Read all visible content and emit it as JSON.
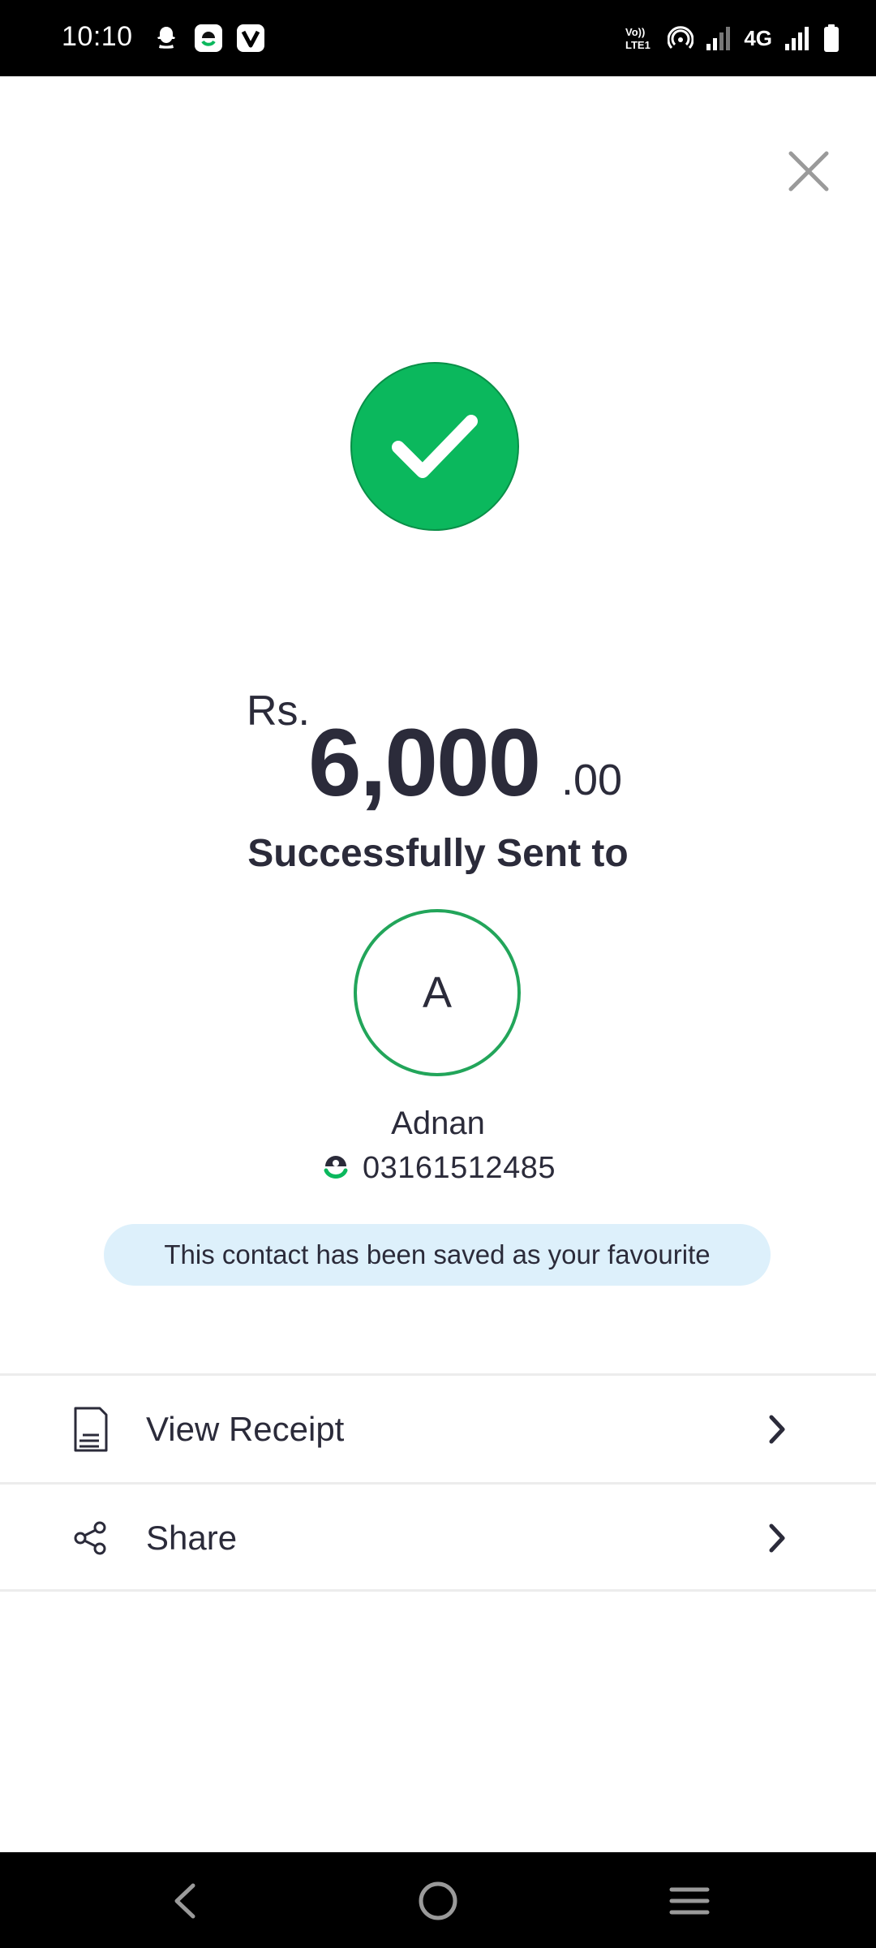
{
  "status_bar": {
    "time": "10:10",
    "network_type": "4G",
    "notification_icons": [
      "snapchat-icon",
      "easypaisa-app-icon",
      "v-app-icon"
    ],
    "system_icons": [
      "volte-icon",
      "hotspot-icon",
      "signal-icon",
      "signal-icon",
      "battery-icon"
    ]
  },
  "transaction": {
    "currency": "Rs.",
    "amount_main": "6,000",
    "amount_decimal": ".00",
    "status_text": "Successfully Sent to"
  },
  "recipient": {
    "initial": "A",
    "name": "Adnan",
    "number": "03161512485",
    "wallet_icon": "easypaisa-icon"
  },
  "notice": {
    "text": "This contact has been saved as your favourite"
  },
  "actions": [
    {
      "label": "View Receipt",
      "icon": "receipt-icon"
    },
    {
      "label": "Share",
      "icon": "share-icon"
    }
  ],
  "colors": {
    "success_green": "#0bb85d",
    "avatar_border": "#22a55a",
    "notice_bg": "#ddf0fb",
    "text_dark": "#2b2b3a"
  },
  "nav": [
    "back-icon",
    "home-icon",
    "recents-icon"
  ]
}
